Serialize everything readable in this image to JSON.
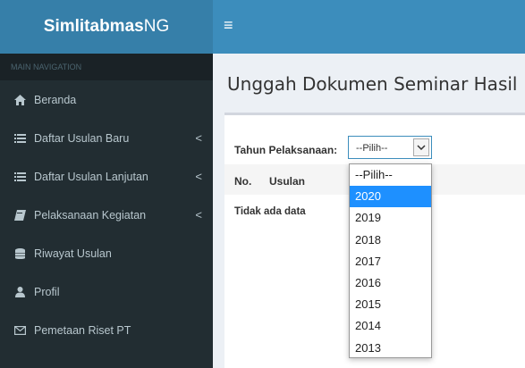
{
  "app": {
    "logo_bold": "Simlitabmas",
    "logo_light": "NG"
  },
  "sidebar": {
    "header": "MAIN NAVIGATION",
    "items": [
      {
        "label": "Beranda",
        "icon": "home-icon",
        "has_children": false
      },
      {
        "label": "Daftar Usulan Baru",
        "icon": "list-icon",
        "has_children": true
      },
      {
        "label": "Daftar Usulan Lanjutan",
        "icon": "list-icon",
        "has_children": true
      },
      {
        "label": "Pelaksanaan Kegiatan",
        "icon": "book-icon",
        "has_children": true
      },
      {
        "label": "Riwayat Usulan",
        "icon": "database-icon",
        "has_children": false
      },
      {
        "label": "Profil",
        "icon": "user-icon",
        "has_children": false
      },
      {
        "label": "Pemetaan Riset PT",
        "icon": "envelope-icon",
        "has_children": false
      }
    ],
    "chevron": "<"
  },
  "page": {
    "title": "Unggah Dokumen Seminar Hasil",
    "filter_label": "Tahun Pelaksanaan:",
    "select_value": "--Pilih--",
    "table_headers": [
      "No.",
      "Usulan"
    ],
    "empty_text": "Tidak ada data"
  },
  "dropdown": {
    "options": [
      "--Pilih--",
      "2020",
      "2019",
      "2018",
      "2017",
      "2016",
      "2015",
      "2014",
      "2013"
    ],
    "highlighted": "2020"
  },
  "colors": {
    "topbar": "#3c8dbc",
    "logo_bg": "#367fa9",
    "sidebar_bg": "#222d32",
    "highlight": "#1e90ff"
  }
}
